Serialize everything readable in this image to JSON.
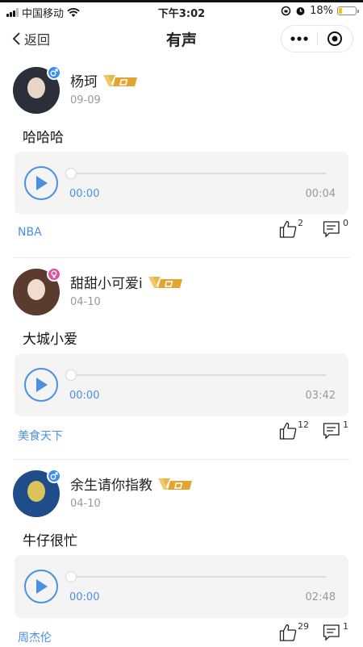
{
  "status_bar": {
    "carrier": "中国移动",
    "time": "下午3:02",
    "battery": "18%",
    "battery_level": 0.18
  },
  "nav": {
    "back_label": "返回",
    "title": "有声"
  },
  "posts": [
    {
      "username": "杨珂",
      "gender": "male",
      "date": "09-09",
      "text": "哈哈哈",
      "current_time": "00:00",
      "duration": "00:04",
      "progress": 0,
      "tag": "NBA",
      "likes": "2",
      "comments": "0",
      "avatar_colors": [
        "#2b2f3a",
        "#e8d7c6"
      ]
    },
    {
      "username": "甜甜小可爱i",
      "gender": "female",
      "date": "04-10",
      "text": "大城小爱",
      "current_time": "00:00",
      "duration": "03:42",
      "progress": 0,
      "tag": "美食天下",
      "likes": "12",
      "comments": "1",
      "avatar_colors": [
        "#5a3b2e",
        "#f1dcd0"
      ]
    },
    {
      "username": "余生请你指教",
      "gender": "male",
      "date": "04-10",
      "text": "牛仔很忙",
      "current_time": "00:00",
      "duration": "02:48",
      "progress": 0,
      "tag": "周杰伦",
      "likes": "29",
      "comments": "1",
      "avatar_colors": [
        "#1f4d8a",
        "#d9c35a"
      ]
    }
  ],
  "colors": {
    "accent": "#4a90e2",
    "vip_gold": "#e8b84a"
  }
}
